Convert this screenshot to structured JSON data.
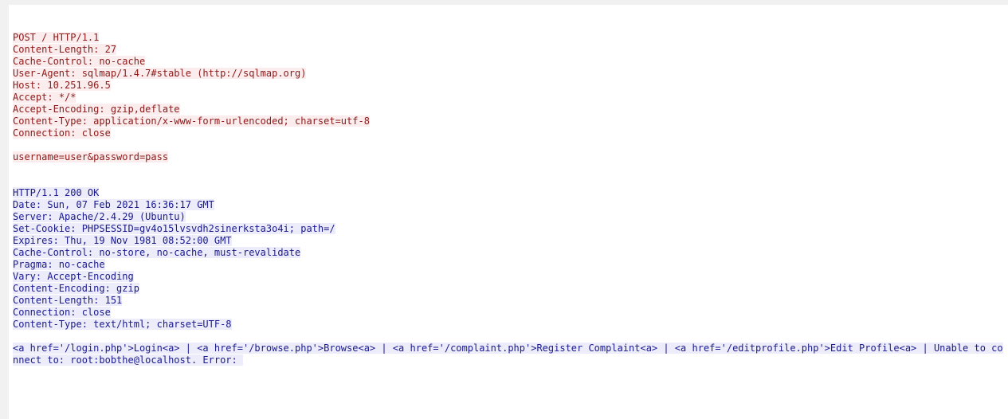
{
  "request": {
    "lines": [
      "POST / HTTP/1.1",
      "Content-Length: 27",
      "Cache-Control: no-cache",
      "User-Agent: sqlmap/1.4.7#stable (http://sqlmap.org)",
      "Host: 10.251.96.5",
      "Accept: */*",
      "Accept-Encoding: gzip,deflate",
      "Content-Type: application/x-www-form-urlencoded; charset=utf-8",
      "Connection: close",
      "",
      "username=user&password=pass"
    ]
  },
  "response": {
    "lines": [
      "HTTP/1.1 200 OK",
      "Date: Sun, 07 Feb 2021 16:36:17 GMT",
      "Server: Apache/2.4.29 (Ubuntu)",
      "Set-Cookie: PHPSESSID=gv4o15lvsvdh2sinerksta3o4i; path=/",
      "Expires: Thu, 19 Nov 1981 08:52:00 GMT",
      "Cache-Control: no-store, no-cache, must-revalidate",
      "Pragma: no-cache",
      "Vary: Accept-Encoding",
      "Content-Encoding: gzip",
      "Content-Length: 151",
      "Connection: close",
      "Content-Type: text/html; charset=UTF-8",
      "",
      "<a href='/login.php'>Login<a> | <a href='/browse.php'>Browse<a> | <a href='/complaint.php'>Register Complaint<a> | <a href='/editprofile.php'>Edit Profile<a> | Unable to connect to: root:bobthe@localhost. Error: "
    ]
  }
}
